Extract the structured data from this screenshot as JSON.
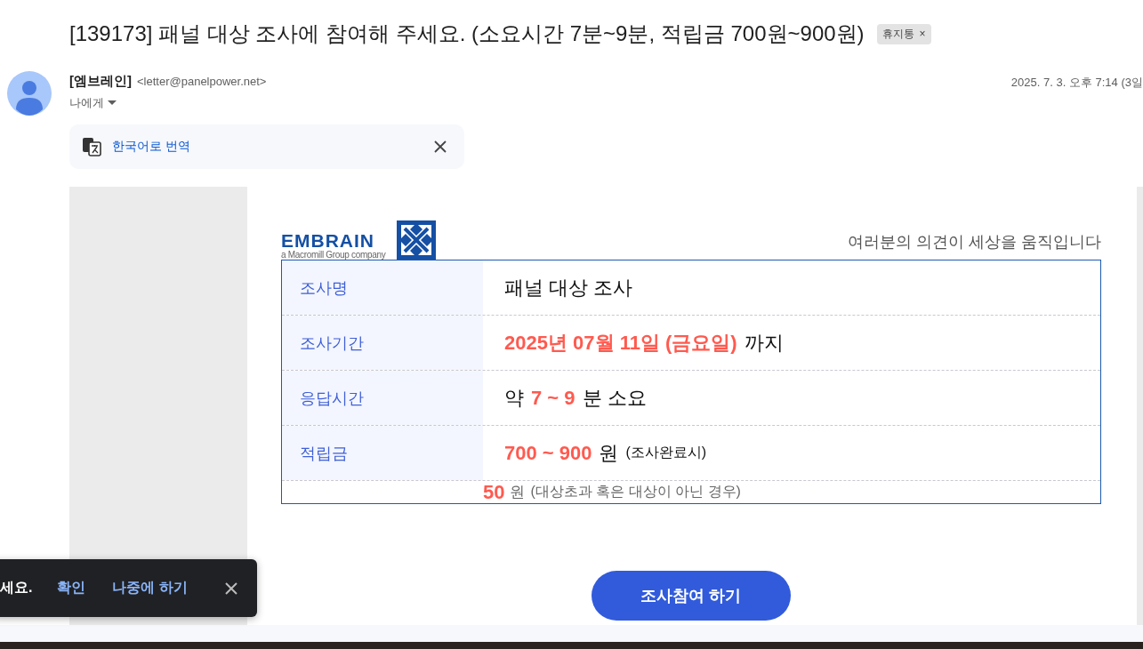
{
  "subject": {
    "title": "[139173] 패널 대상 조사에 참여해 주세요. (소요시간 7분~9분, 적립금 700원~900원)",
    "label": "휴지통",
    "label_close": "×"
  },
  "sender": {
    "name": "[엠브레인]",
    "email": "<letter@panelpower.net>",
    "recipient": "나에게",
    "date": "2025. 7. 3. 오후 7:14 (3일"
  },
  "translate_bar": {
    "label": "한국어로 번역"
  },
  "email_body": {
    "logo": {
      "wordmark": "EMBRAIN",
      "tagline": "a Macromill Group company"
    },
    "slogan": "여러분의 의견이 세상을 움직입니다",
    "rows": [
      {
        "label": "조사명",
        "value": [
          {
            "text": "패널 대상 조사",
            "kind": "plain"
          }
        ]
      },
      {
        "label": "조사기간",
        "value": [
          {
            "text": "2025년 07월 11일 (금요일)",
            "kind": "highlight"
          },
          {
            "text": "까지",
            "kind": "plain"
          }
        ]
      },
      {
        "label": "응답시간",
        "value": [
          {
            "text": "약",
            "kind": "plain"
          },
          {
            "text": "7 ~ 9",
            "kind": "highlight"
          },
          {
            "text": "분 소요",
            "kind": "plain"
          }
        ]
      },
      {
        "label": "적립금",
        "value": [
          {
            "text": "700 ~ 900",
            "kind": "highlight"
          },
          {
            "text": "원",
            "kind": "plain"
          },
          {
            "text": "(조사완료시)",
            "kind": "small"
          }
        ]
      }
    ],
    "note": [
      {
        "text": "50",
        "kind": "highlight"
      },
      {
        "text": "원",
        "kind": "plain"
      },
      {
        "text": "(대상초과 혹은 대상이 아닌 경우)",
        "kind": "small"
      }
    ],
    "button": "조사참여 하기"
  },
  "snackbar": {
    "message": "세요.",
    "actions": [
      "확인",
      "나중에 하기"
    ]
  }
}
